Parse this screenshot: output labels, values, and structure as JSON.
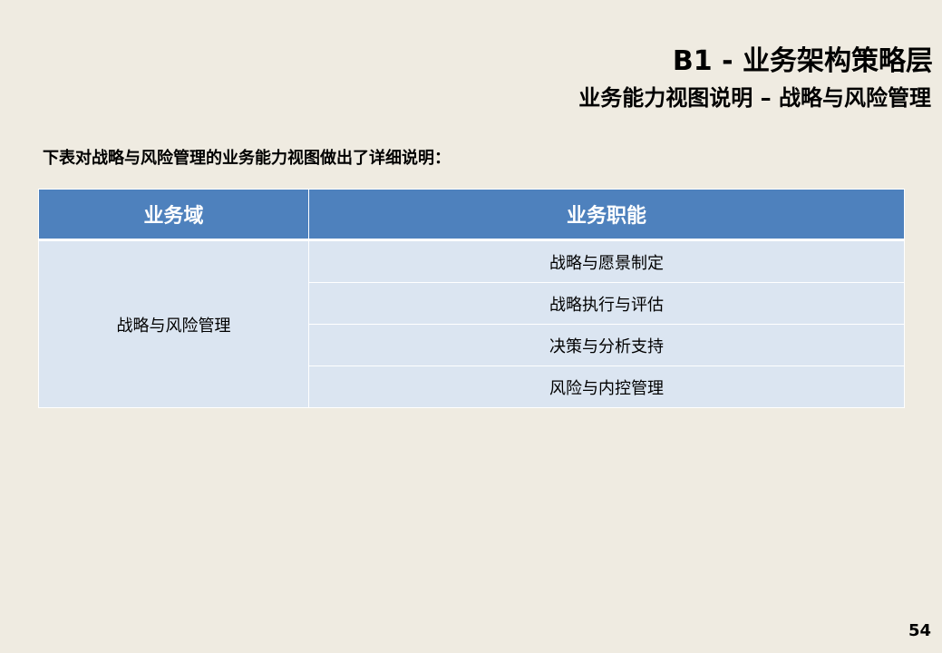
{
  "slide": {
    "title": "B1 - 业务架构策略层",
    "subtitle": "业务能力视图说明 – 战略与风险管理",
    "intro": "下表对战略与风险管理的业务能力视图做出了详细说明：",
    "page_number": "54"
  },
  "table": {
    "headers": [
      "业务域",
      "业务职能"
    ],
    "domain": "战略与风险管理",
    "functions": [
      "战略与愿景制定",
      "战略执行与评估",
      "决策与分析支持",
      "风险与内控管理"
    ]
  }
}
